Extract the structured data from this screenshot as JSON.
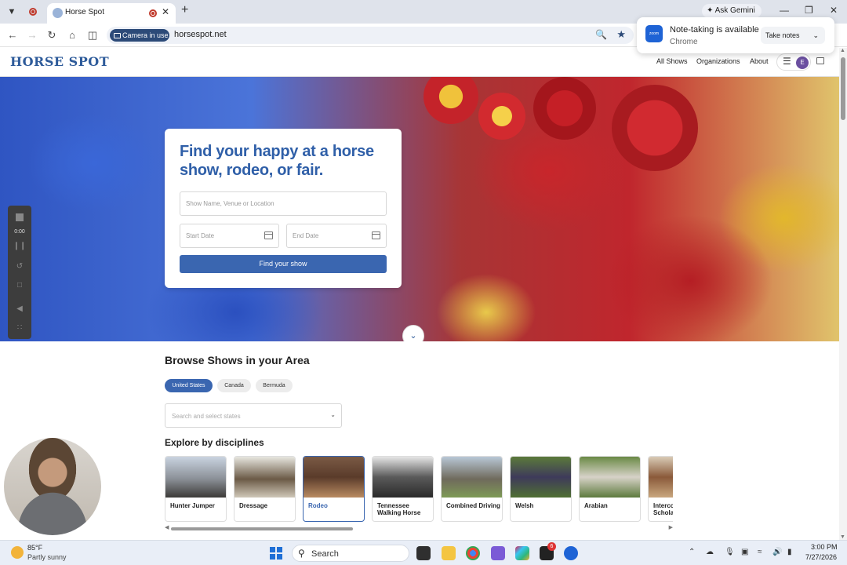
{
  "browser": {
    "tab_title": "Horse Spot",
    "ask_gemini": "Ask Gemini",
    "camera_pill": "Camera in use",
    "url": "horsespot.net"
  },
  "zoom_popup": {
    "logo": "zoom",
    "title": "Note-taking is available",
    "subtitle": "Chrome",
    "button": "Take notes"
  },
  "site": {
    "logo": "HORSE SPOT",
    "nav": [
      "All Shows",
      "Organizations",
      "About"
    ],
    "avatar_letter": "E"
  },
  "hero": {
    "headline": "Find your happy at a horse show, rodeo, or fair.",
    "search_placeholder": "Show Name, Venue or Location",
    "start_date_placeholder": "Start Date",
    "end_date_placeholder": "End Date",
    "cta": "Find your show"
  },
  "recorder": {
    "time": "0:00"
  },
  "browse": {
    "title": "Browse Shows in your Area",
    "countries": [
      "United States",
      "Canada",
      "Bermuda"
    ],
    "selected_country": "United States",
    "state_placeholder": "Search and select states"
  },
  "explore": {
    "title": "Explore by disciplines",
    "disciplines": [
      {
        "label": "Hunter Jumper"
      },
      {
        "label": "Dressage"
      },
      {
        "label": "Rodeo"
      },
      {
        "label": "Tennessee Walking Horse"
      },
      {
        "label": "Combined Driving"
      },
      {
        "label": "Welsh"
      },
      {
        "label": "Arabian"
      },
      {
        "label": "Intercollegiate Scholastic"
      }
    ],
    "selected": "Rodeo"
  },
  "taskbar": {
    "temp": "85°F",
    "weather": "Partly sunny",
    "search": "Search",
    "badge": "6",
    "time": "3:00 PM",
    "date": "7/27/2026"
  },
  "colors": {
    "brand": "#2e5b9a",
    "accent": "#3a66b0"
  }
}
